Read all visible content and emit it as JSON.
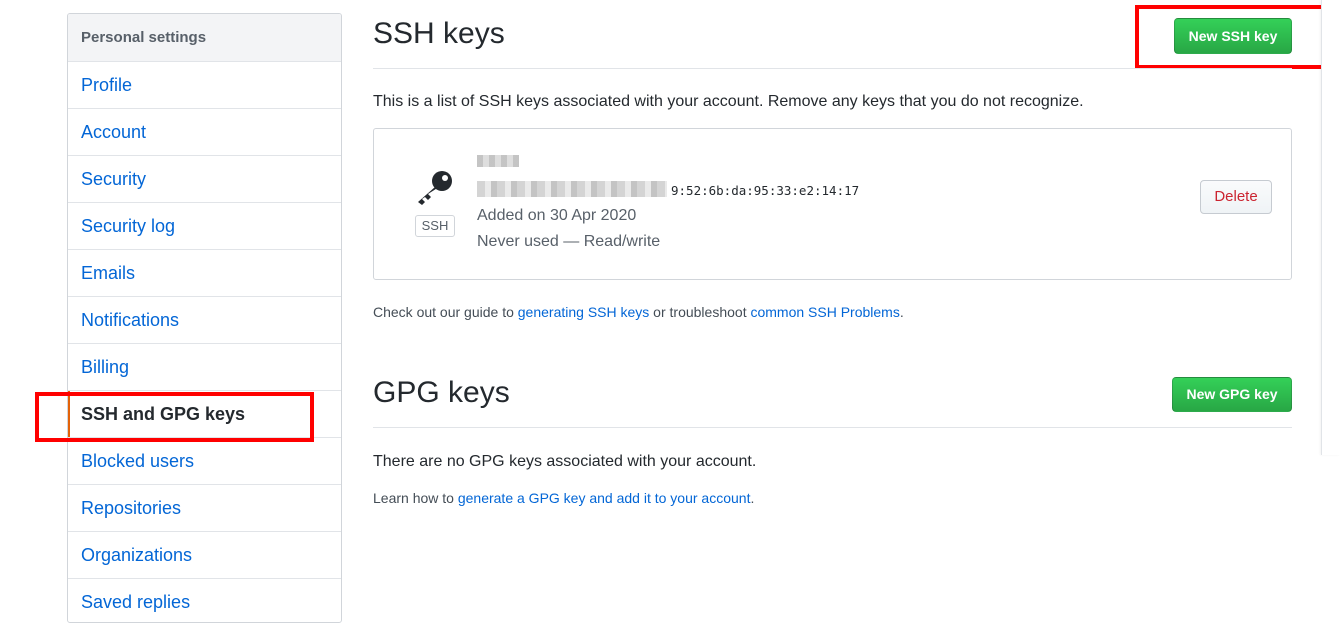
{
  "sidebar": {
    "header": "Personal settings",
    "items": [
      {
        "label": "Profile"
      },
      {
        "label": "Account"
      },
      {
        "label": "Security"
      },
      {
        "label": "Security log"
      },
      {
        "label": "Emails"
      },
      {
        "label": "Notifications"
      },
      {
        "label": "Billing"
      },
      {
        "label": "SSH and GPG keys",
        "selected": true
      },
      {
        "label": "Blocked users"
      },
      {
        "label": "Repositories"
      },
      {
        "label": "Organizations"
      },
      {
        "label": "Saved replies"
      }
    ]
  },
  "ssh": {
    "title": "SSH keys",
    "new_button": "New SSH key",
    "description": "This is a list of SSH keys associated with your account. Remove any keys that you do not recognize.",
    "key": {
      "badge": "SSH",
      "fingerprint_visible": "9:52:6b:da:95:33:e2:14:17",
      "added": "Added on 30 Apr 2020",
      "usage": "Never used — Read/write",
      "delete_label": "Delete"
    },
    "guide": {
      "prefix": "Check out our guide to ",
      "link1": "generating SSH keys",
      "middle": " or troubleshoot ",
      "link2": "common SSH Problems",
      "suffix": "."
    }
  },
  "gpg": {
    "title": "GPG keys",
    "new_button": "New GPG key",
    "empty": "There are no GPG keys associated with your account.",
    "learn": {
      "prefix": "Learn how to ",
      "link": "generate a GPG key and add it to your account",
      "suffix": "."
    }
  },
  "colors": {
    "link": "#0366d6",
    "primary_button": "#28a745",
    "danger": "#cb2431",
    "annotation": "#ff0000",
    "selected_marker": "#e36209"
  }
}
